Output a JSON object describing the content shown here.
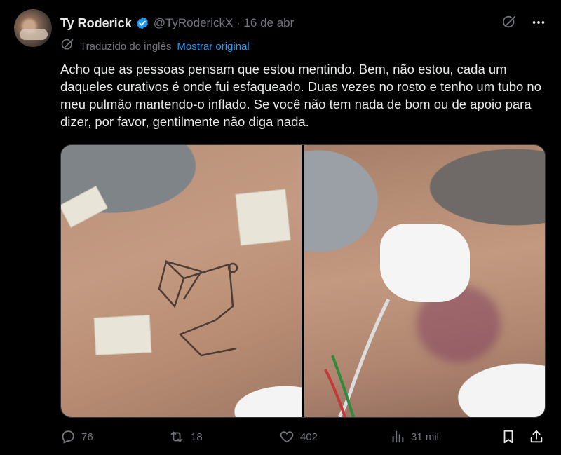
{
  "tweet": {
    "author_name": "Ty Roderick",
    "handle": "@TyRoderickX · 16 de abr",
    "translated_label": "Traduzido do inglês",
    "show_original": "Mostrar original",
    "body": "Acho que as pessoas pensam que estou mentindo. Bem, não estou, cada um daqueles curativos é onde fui esfaqueado. Duas vezes no rosto e tenho um tubo no meu pulmão mantendo-o inflado. Se você não tem nada de bom ou de apoio para dizer, por favor, gentilmente não diga nada."
  },
  "actions": {
    "replies": "76",
    "reposts": "18",
    "likes": "402",
    "views": "31 mil"
  },
  "colors": {
    "background": "#000000",
    "text": "#e7e9ea",
    "secondary": "#71767b",
    "accent": "#1d9bf0"
  },
  "icons": [
    "verified-badge-icon",
    "grok-icon",
    "more-icon",
    "translate-icon",
    "reply-icon",
    "repost-icon",
    "like-icon",
    "views-icon",
    "bookmark-icon",
    "share-icon"
  ]
}
